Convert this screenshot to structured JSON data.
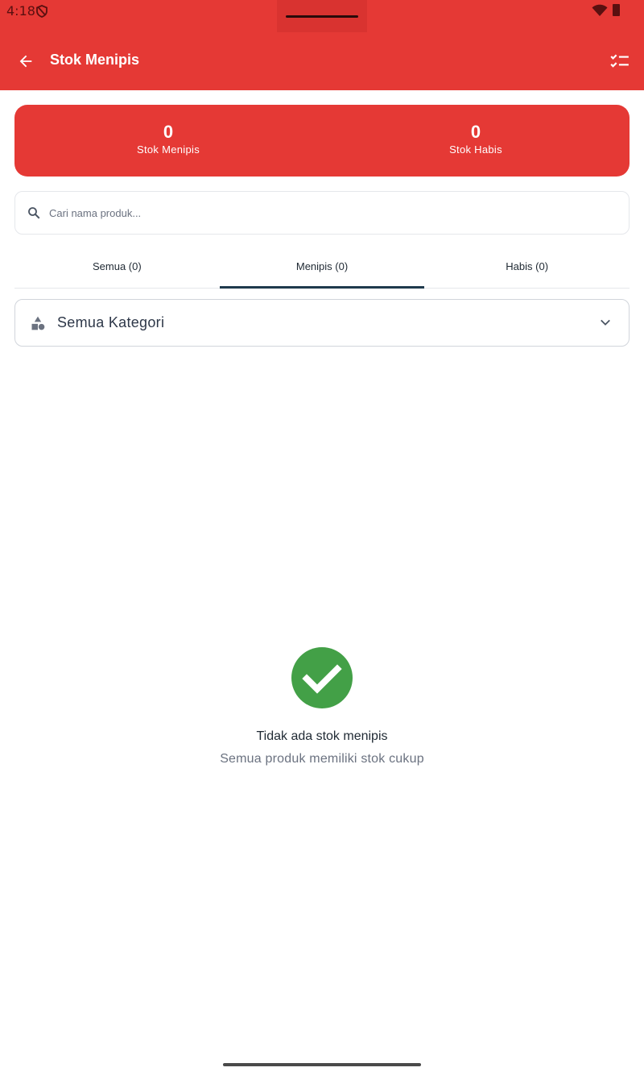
{
  "status_bar": {
    "time": "4:18"
  },
  "app_bar": {
    "title": "Stok Menipis",
    "back_icon": "arrow-back-icon",
    "action_icon": "checklist-icon"
  },
  "summary": {
    "low_stock_count": "0",
    "low_stock_label": "Stok Menipis",
    "out_of_stock_count": "0",
    "out_of_stock_label": "Stok Habis"
  },
  "search": {
    "placeholder": "Cari nama produk..."
  },
  "tabs": [
    {
      "label": "Semua (0)",
      "active": false
    },
    {
      "label": "Menipis (0)",
      "active": true
    },
    {
      "label": "Habis (0)",
      "active": false
    }
  ],
  "category_filter": {
    "selected": "Semua Kategori"
  },
  "empty_state": {
    "title": "Tidak ada stok menipis",
    "subtitle": "Semua produk memiliki stok cukup",
    "icon": "check-circle-icon"
  },
  "colors": {
    "primary": "#e53935",
    "success": "#43a047",
    "tab_indicator": "#1f3a4d"
  }
}
